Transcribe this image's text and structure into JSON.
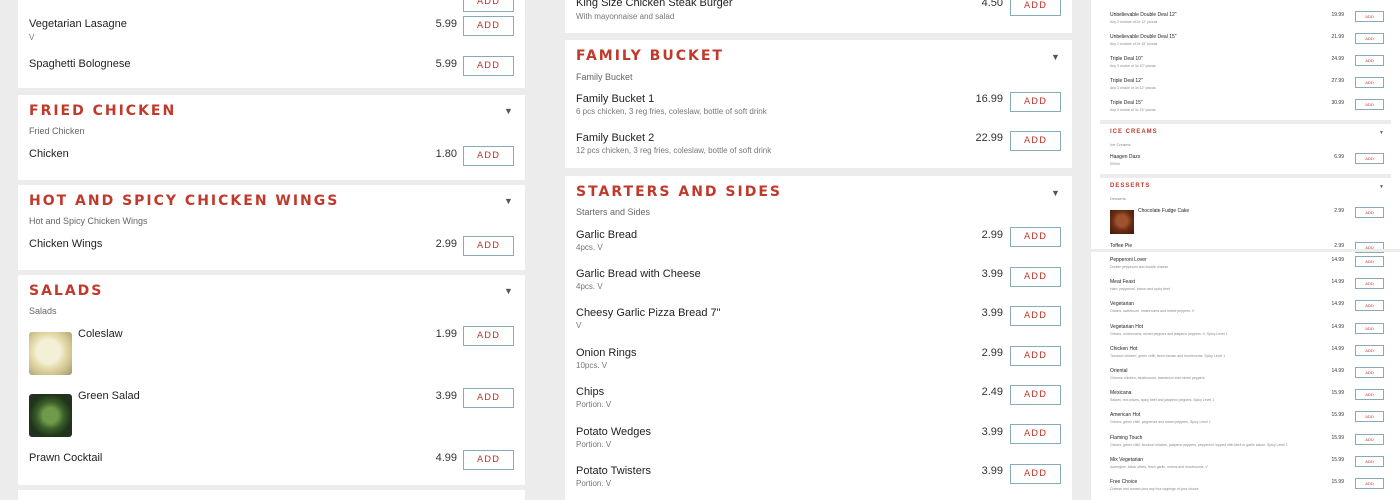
{
  "add_label": "ADD",
  "col1": {
    "top_items": [
      {
        "name": "Vegetarian Lasagne",
        "desc": "V",
        "price": "5.99"
      },
      {
        "name": "Spaghetti Bolognese",
        "price": "5.99"
      }
    ],
    "fried": {
      "title": "Fried Chicken",
      "sub": "Fried Chicken",
      "items": [
        {
          "name": "Chicken",
          "price": "1.80"
        }
      ]
    },
    "wings": {
      "title": "Hot and Spicy Chicken Wings",
      "sub": "Hot and Spicy Chicken Wings",
      "items": [
        {
          "name": "Chicken Wings",
          "price": "2.99"
        }
      ]
    },
    "salads": {
      "title": "Salads",
      "sub": "Salads",
      "items": [
        {
          "name": "Coleslaw",
          "price": "1.99"
        },
        {
          "name": "Green Salad",
          "price": "3.99"
        },
        {
          "name": "Prawn Cocktail",
          "price": "4.99"
        }
      ]
    }
  },
  "col2": {
    "top_item": {
      "name": "King Size Chicken Steak Burger",
      "desc": "With mayonnaise and salad",
      "price": "4.50"
    },
    "family": {
      "title": "Family Bucket",
      "sub": "Family Bucket",
      "items": [
        {
          "name": "Family Bucket 1",
          "desc": "6 pcs chicken, 3 reg fries, coleslaw, bottle of soft drink",
          "price": "16.99"
        },
        {
          "name": "Family Bucket 2",
          "desc": "12 pcs chicken, 3 reg fries, coleslaw, bottle of soft drink",
          "price": "22.99"
        }
      ]
    },
    "starters": {
      "title": "Starters and Sides",
      "sub": "Starters and Sides",
      "items": [
        {
          "name": "Garlic Bread",
          "desc": "4pcs. V",
          "price": "2.99"
        },
        {
          "name": "Garlic Bread with Cheese",
          "desc": "4pcs. V",
          "price": "3.99"
        },
        {
          "name": "Cheesy Garlic Pizza Bread 7\"",
          "desc": "V",
          "price": "3.99"
        },
        {
          "name": "Onion Rings",
          "desc": "10pcs. V",
          "price": "2.99"
        },
        {
          "name": "Chips",
          "desc": "Portion. V",
          "price": "2.49"
        },
        {
          "name": "Potato Wedges",
          "desc": "Portion. V",
          "price": "3.99"
        },
        {
          "name": "Potato Twisters",
          "desc": "Portion. V",
          "price": "3.99"
        }
      ]
    }
  },
  "col3": {
    "top_deals": [
      {
        "name": "Unbelievable Double Deal 12\"",
        "desc": "Any 2 choices of 2x 12\" pizzas",
        "price": "19.99"
      },
      {
        "name": "Unbelievable Double Deal 15\"",
        "desc": "Any 2 choices of 2x 15\" pizzas",
        "price": "21.99"
      },
      {
        "name": "Triple Deal 10\"",
        "desc": "Any 3 choice of 3x 10\" pizzas",
        "price": "24.99"
      },
      {
        "name": "Triple Deal 12\"",
        "desc": "Any 3 choice of 3x 12\" pizzas",
        "price": "27.99"
      },
      {
        "name": "Triple Deal 15\"",
        "desc": "Any 3 choice of 3x 15\" pizzas",
        "price": "30.99"
      }
    ],
    "ice": {
      "title": "Ice Creams",
      "sub": "Ice Creams",
      "items": [
        {
          "name": "Haagen Dazs",
          "desc": "500ml",
          "price": "6.99"
        }
      ]
    },
    "desserts": {
      "title": "Desserts",
      "sub": "Desserts",
      "items": [
        {
          "name": "Chocolate Fudge Cake",
          "price": "2.99"
        },
        {
          "name": "Toffee Pie",
          "price": "2.99"
        }
      ]
    },
    "pizzas": [
      {
        "name": "Pepperoni Lover",
        "desc": "Double pepperoni and double cheese",
        "price": "14.99"
      },
      {
        "name": "Meat Feast",
        "desc": "Ham, pepperoni, bacon and spicy beef",
        "price": "14.99"
      },
      {
        "name": "Vegetarian",
        "desc": "Onions, sweetcorn, mushrooms and mixed peppers. V",
        "price": "14.99"
      },
      {
        "name": "Vegetarian Hot",
        "desc": "Onions, mushrooms, mixed peppers and jalapeno peppers. V, Spicy Level 1",
        "price": "14.99"
      },
      {
        "name": "Chicken Hot",
        "desc": "Tandoori chicken, green chilli, fresh tomato and mushrooms. Spicy Level 1",
        "price": "14.99"
      },
      {
        "name": "Oriental",
        "desc": "Chinese chicken, mushrooms, sweetcorn and mixed peppers",
        "price": "14.99"
      },
      {
        "name": "Mexicana",
        "desc": "Salami, red onions, spicy beef and jalapeno peppers. Spicy Level 1",
        "price": "15.99"
      },
      {
        "name": "American Hot",
        "desc": "Onions, green chilli, pepperoni and mixed peppers. Spicy Level 1",
        "price": "15.99"
      },
      {
        "name": "Flaming Touch",
        "desc": "Onions, green chilli, tandoori chicken, jalapeno peppers, pepperoni, topped with tarrif or garlic sauce. Spicy Level 1",
        "price": "15.99"
      },
      {
        "name": "Mix Vegetarian",
        "desc": "Aubergine, black olives, fresh garlic, onions and mushrooms. V",
        "price": "15.99"
      },
      {
        "name": "Free Choice",
        "desc": "Cheese and tomato plus any four toppings of your choice",
        "price": "15.99"
      }
    ]
  }
}
